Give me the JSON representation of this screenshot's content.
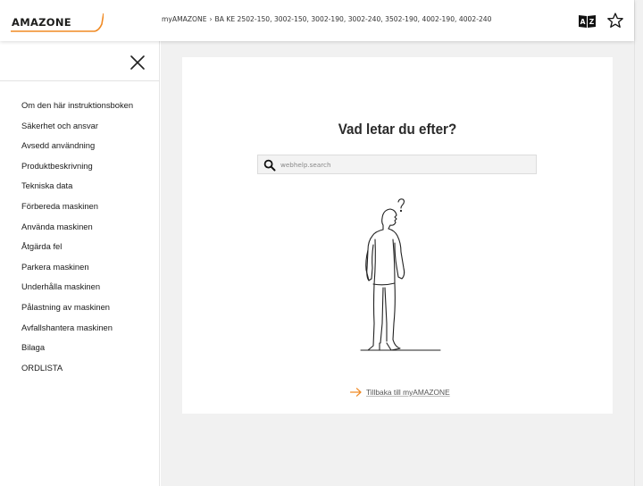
{
  "header": {
    "logo": "AMAZONE",
    "breadcrumb": {
      "root": "myAMAZONE",
      "separator": "›",
      "current": "BA KE 2502-150, 3002-150, 3002-190, 3002-240, 3502-190, 4002-190, 4002-240"
    },
    "icons": [
      "glossary-icon",
      "star-icon"
    ]
  },
  "sidebar": {
    "close_icon": "close-icon",
    "items": [
      {
        "label": "Om den här instruktionsboken"
      },
      {
        "label": "Säkerhet och ansvar"
      },
      {
        "label": "Avsedd användning"
      },
      {
        "label": "Produktbeskrivning"
      },
      {
        "label": "Tekniska data"
      },
      {
        "label": "Förbereda maskinen"
      },
      {
        "label": "Använda maskinen"
      },
      {
        "label": "Åtgärda fel"
      },
      {
        "label": "Parkera maskinen"
      },
      {
        "label": "Underhålla maskinen"
      },
      {
        "label": "Pålastning av maskinen"
      },
      {
        "label": "Avfallshantera maskinen"
      },
      {
        "label": "Bilaga"
      },
      {
        "label": "ORDLISTA"
      }
    ]
  },
  "main": {
    "title": "Vad letar du efter?",
    "search": {
      "placeholder": "webhelp.search",
      "value": ""
    },
    "illustration": "person-question-mark",
    "back_link": "Tillbaka till myAMAZONE"
  },
  "colors": {
    "accent": "#f08a24",
    "background": "#f1f1f1",
    "card": "#ffffff",
    "text": "#1a1a1a"
  }
}
